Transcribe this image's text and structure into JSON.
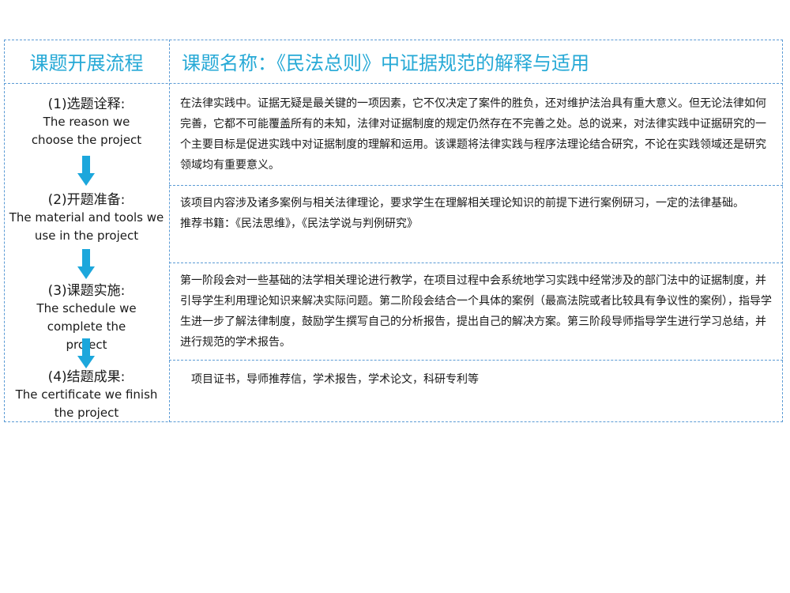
{
  "header": {
    "left_title": "课题开展流程",
    "right_title": "课题名称：《民法总则》中证据规范的解释与适用"
  },
  "steps": [
    {
      "cn": "(1)选题诠释:",
      "en": "The reason we choose the project",
      "content": [
        "在法律实践中。证据无疑是最关键的一项因素，它不仅决定了案件的胜负，还对维护法治具有重大意义。但无论法律如何完善，它都不可能覆盖所有的未知，法律对证据制度的规定仍然存在不完善之处。总的说来，对法律实践中证据研究的一个主要目标是促进实践中对证据制度的理解和运用。该课题将法律实践与程序法理论结合研究，不论在实践领域还是研究领域均有重要意义。"
      ]
    },
    {
      "cn": "(2)开题准备:",
      "en": "The material and tools we use in the project",
      "content": [
        "该项目内容涉及诸多案例与相关法律理论，要求学生在理解相关理论知识的前提下进行案例研习，一定的法律基础。",
        "推荐书籍：《民法思维》，《民法学说与判例研究》"
      ]
    },
    {
      "cn": "(3)课题实施:",
      "en": "The schedule we complete the project",
      "content": [
        "第一阶段会对一些基础的法学相关理论进行教学，在项目过程中会系统地学习实践中经常涉及的部门法中的证据制度，并引导学生利用理论知识来解决实际问题。第二阶段会结合一个具体的案例（最高法院或者比较具有争议性的案例），指导学生进一步了解法律制度，鼓励学生撰写自己的分析报告，提出自己的解决方案。第三阶段导师指导学生进行学习总结，并进行规范的学术报告。"
      ]
    },
    {
      "cn": "(4)结题成果:",
      "en": "The certificate we finish the project",
      "content": [
        "项目证书，导师推荐信，学术报告，学术论文，科研专利等"
      ]
    }
  ]
}
